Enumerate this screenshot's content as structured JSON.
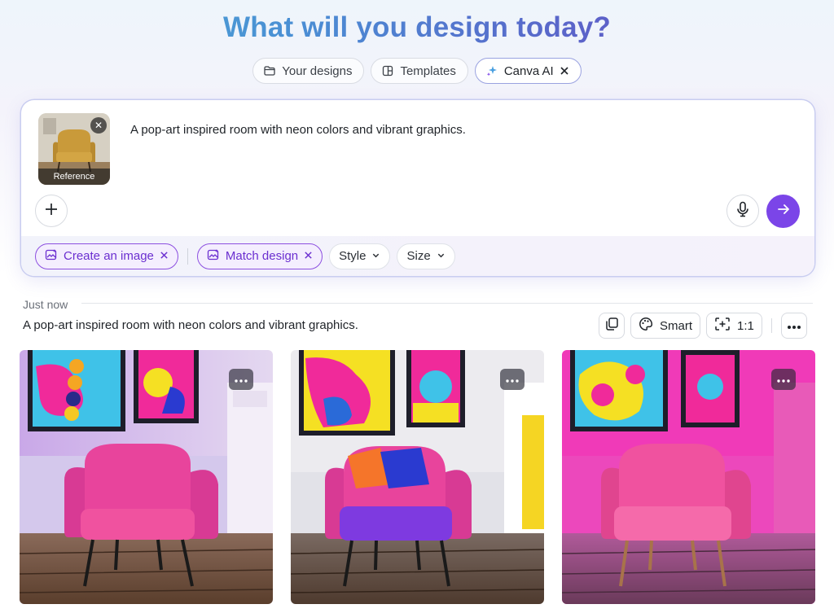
{
  "headline": "What will you design today?",
  "tabs": [
    {
      "label": "Your designs",
      "icon": "folder-icon"
    },
    {
      "label": "Templates",
      "icon": "template-icon"
    },
    {
      "label": "Canva AI",
      "icon": "sparkle-icon",
      "active": true
    }
  ],
  "prompt": {
    "reference_label": "Reference",
    "text": "A pop-art inspired room with neon colors and vibrant graphics."
  },
  "chips": {
    "create_image": "Create an image",
    "match_design": "Match design",
    "style": "Style",
    "size": "Size"
  },
  "results": {
    "timestamp": "Just now",
    "prompt": "A pop-art inspired room with neon colors and vibrant graphics.",
    "smart_label": "Smart",
    "ratio_label": "1:1"
  },
  "colors": {
    "accent": "#7b45e8",
    "chip_purple": "#6b2fd0"
  }
}
